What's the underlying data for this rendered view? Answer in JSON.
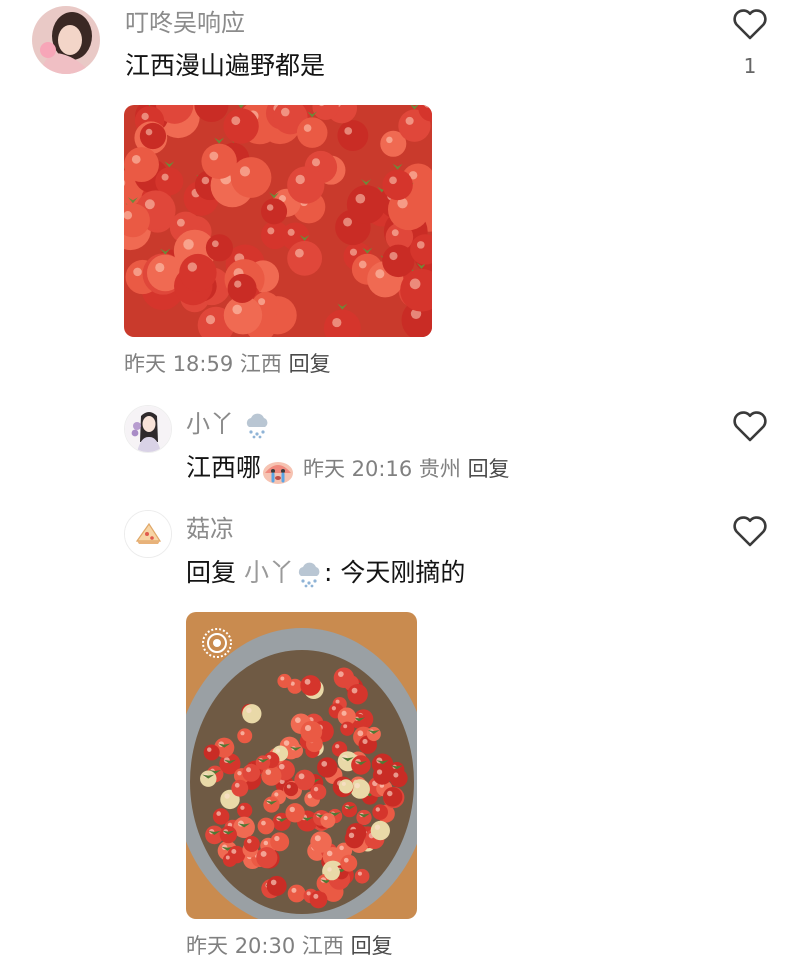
{
  "comment": {
    "author": "叮咚吴响应",
    "text": "江西漫山遍野都是",
    "like_count": "1",
    "date": "昨天",
    "time": "18:59",
    "location": "江西",
    "reply_label": "回复",
    "like_icon": "heart-outline-icon"
  },
  "replies": [
    {
      "author": "小丫",
      "author_emoji": "snow-cloud-emoji",
      "text": "江西哪",
      "text_emoji": "crying-face-emoji",
      "date": "昨天",
      "time": "20:16",
      "location": "贵州",
      "reply_label": "回复"
    },
    {
      "author": "菇凉",
      "reply_prefix": "回复",
      "reply_to": "小丫",
      "reply_to_emoji": "snow-cloud-emoji",
      "text": ": 今天刚摘的",
      "date": "昨天",
      "time": "20:30",
      "location": "江西",
      "reply_label": "回复"
    }
  ],
  "colors": {
    "berry_red": "#d8322e",
    "bowl_metal": "#9aa0a4",
    "muted_text": "#8b8b8b"
  }
}
